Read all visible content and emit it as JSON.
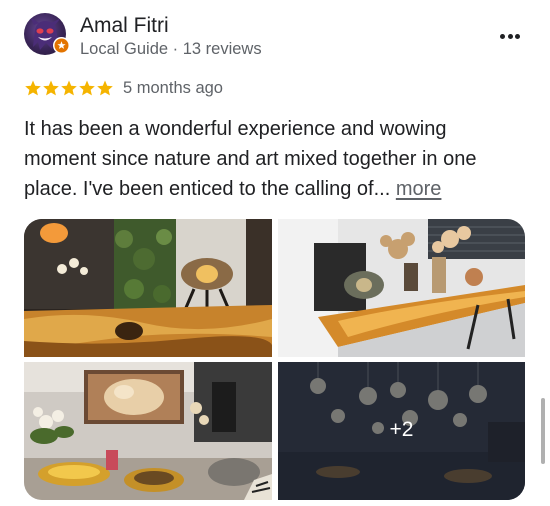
{
  "review": {
    "author": "Amal Fitri",
    "author_meta": "Local Guide · 13 reviews",
    "rating": 5,
    "rating_max": 5,
    "time_ago": "5 months ago",
    "text": "It has been a wonderful experience and wowing moment since nature and art mixed together in one place. I've been enticed to the calling of...",
    "more_label": "more"
  },
  "photos": {
    "extra_count_label": "+2"
  },
  "icons": {
    "menu": "more-vert-icon",
    "star": "star-icon",
    "badge": "local-guide-badge-icon"
  },
  "colors": {
    "star": "#f5b400",
    "secondary_text": "#5f6368",
    "badge": "#e37400"
  }
}
